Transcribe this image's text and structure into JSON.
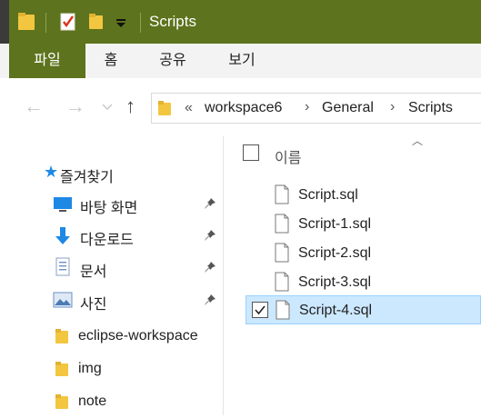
{
  "window": {
    "title": "Scripts"
  },
  "ribbon": {
    "tabs": [
      "파일",
      "홈",
      "공유",
      "보기"
    ]
  },
  "address": {
    "overflow": "«",
    "crumbs": [
      "workspace6",
      "General",
      "Scripts"
    ]
  },
  "nav": {
    "section": "즐겨찾기",
    "items": [
      {
        "label": "바탕 화면",
        "icon": "desktop-icon",
        "pinned": true
      },
      {
        "label": "다운로드",
        "icon": "download-arrow-icon",
        "pinned": true
      },
      {
        "label": "문서",
        "icon": "documents-icon",
        "pinned": true
      },
      {
        "label": "사진",
        "icon": "pictures-icon",
        "pinned": true
      },
      {
        "label": "eclipse-workspace",
        "icon": "folder-icon",
        "pinned": false
      },
      {
        "label": "img",
        "icon": "folder-icon",
        "pinned": false
      },
      {
        "label": "note",
        "icon": "folder-icon",
        "pinned": false
      }
    ]
  },
  "list": {
    "column_name": "이름",
    "files": [
      {
        "name": "Script.sql",
        "selected": false
      },
      {
        "name": "Script-1.sql",
        "selected": false
      },
      {
        "name": "Script-2.sql",
        "selected": false
      },
      {
        "name": "Script-3.sql",
        "selected": false
      },
      {
        "name": "Script-4.sql",
        "selected": true
      }
    ]
  },
  "colors": {
    "titlebar": "#5d731d",
    "selection": "#cce8ff",
    "folder": "#f3c640",
    "accent": "#1e88e5"
  }
}
